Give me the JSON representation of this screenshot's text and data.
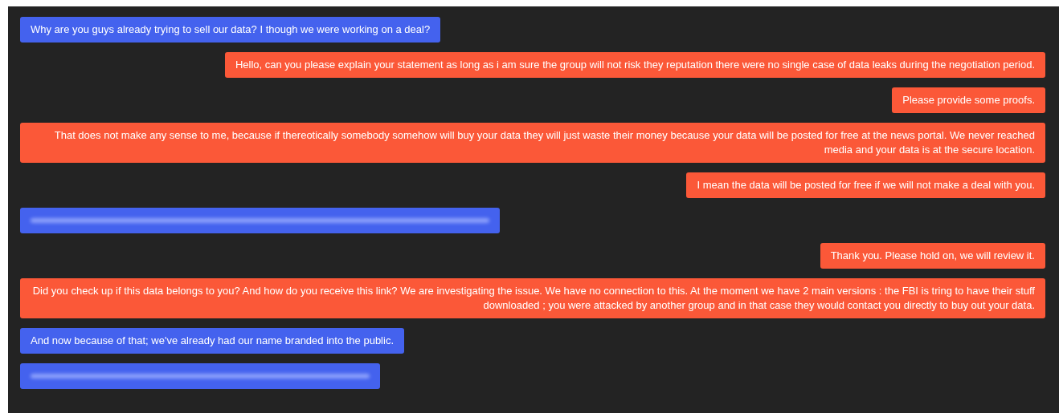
{
  "messages": [
    {
      "kind": "sent",
      "text": "Why are you guys already trying to sell our data? I though we were working on a deal?"
    },
    {
      "kind": "received",
      "text": "Hello, can you please explain your statement as long as i am sure the group will not risk they reputation there were no single case of data leaks during the negotiation period."
    },
    {
      "kind": "received",
      "text": "Please provide some proofs."
    },
    {
      "kind": "received",
      "text": "That does not make any sense to me, because if thereotically somebody somehow will buy your data they will just waste their money because your data will be posted for free at the news portal. We never reached media and your data is at the secure location."
    },
    {
      "kind": "received",
      "text": "I mean the data will be posted for free if we will not make a deal with you."
    },
    {
      "kind": "blurred_link"
    },
    {
      "kind": "received",
      "text": "Thank you. Please hold on, we will review it."
    },
    {
      "kind": "received",
      "text": "Did you check up if this data belongs to you? And how do you receive this link? We are investigating the issue. We have no connection to this. At the moment we have 2 main versions : the FBI is tring to have their stuff downloaded ; you were attacked by another group and in that case they would contact you directly to buy out your data."
    },
    {
      "kind": "sent",
      "text": "And now because of that; we've already had our name branded into the public."
    },
    {
      "kind": "blurred_link"
    }
  ]
}
